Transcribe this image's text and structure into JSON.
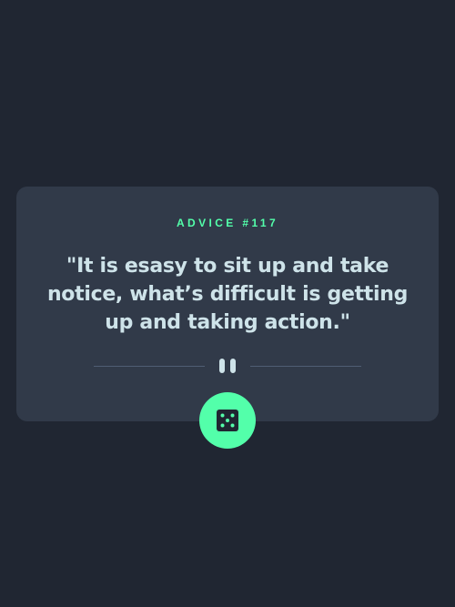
{
  "advice": {
    "id_label": "ADVICE #117",
    "quote": "\"It is esasy to sit up and take notice, what’s difficult is getting up and taking action.\""
  },
  "icons": {
    "divider": "pause-icon",
    "button": "dice-icon"
  },
  "colors": {
    "background": "#202632",
    "card": "#313a49",
    "accent": "#53ffaa",
    "text": "#cee3e9",
    "divider": "#4f5d74"
  }
}
